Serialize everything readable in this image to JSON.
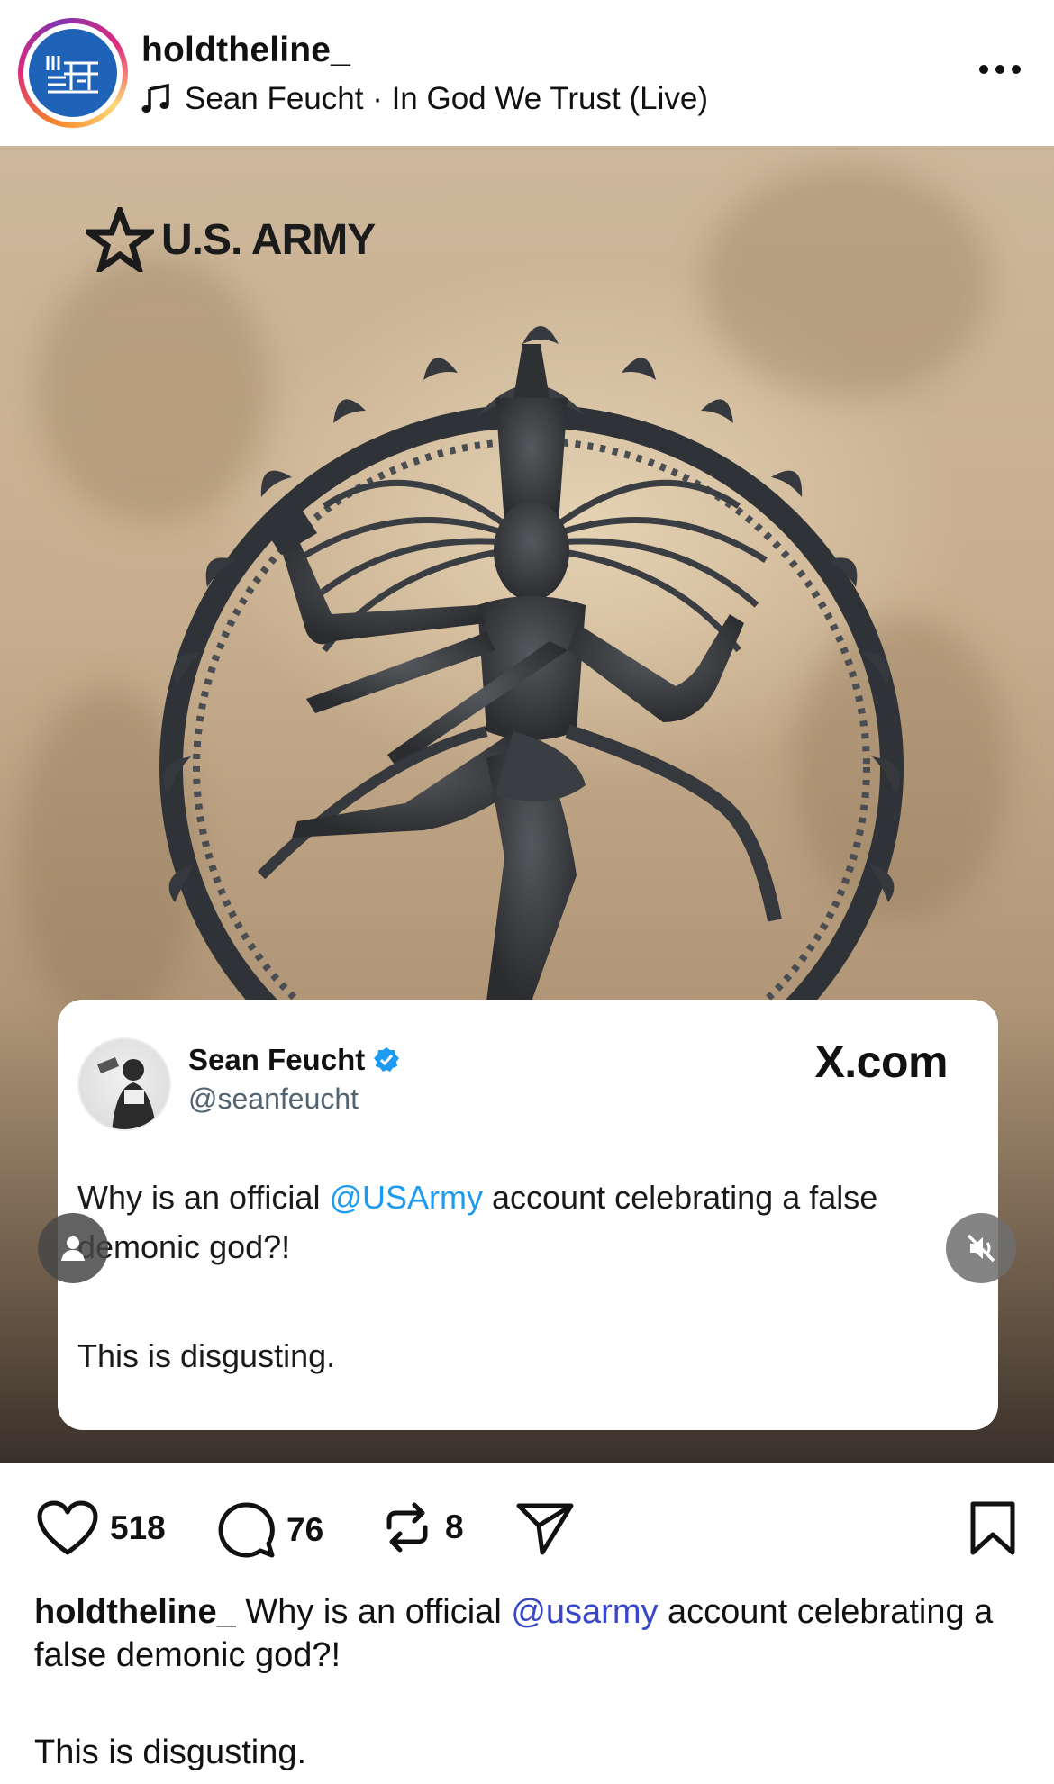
{
  "header": {
    "username": "holdtheline_",
    "music": "Sean Feucht · In God We Trust (Live)"
  },
  "media": {
    "army_logo_text": "U.S. ARMY"
  },
  "tweet": {
    "name": "Sean Feucht",
    "handle": "@seanfeucht",
    "brand": "X.com",
    "text_before": "Why is an official ",
    "mention": "@USArmy",
    "text_after": " account celebrating a false demonic god?!",
    "text_line2": "This is disgusting."
  },
  "actions": {
    "likes": "518",
    "comments": "76",
    "reposts": "8"
  },
  "caption": {
    "user": "holdtheline_",
    "text_before": " Why is an official ",
    "mention": "@usarmy",
    "text_after": " account celebrating a false demonic god?!",
    "line2": "This is disgusting."
  },
  "colors": {
    "link_blue": "#1d9bf0",
    "caption_mention": "#3847c9",
    "logo_blue": "#1f63b8"
  }
}
